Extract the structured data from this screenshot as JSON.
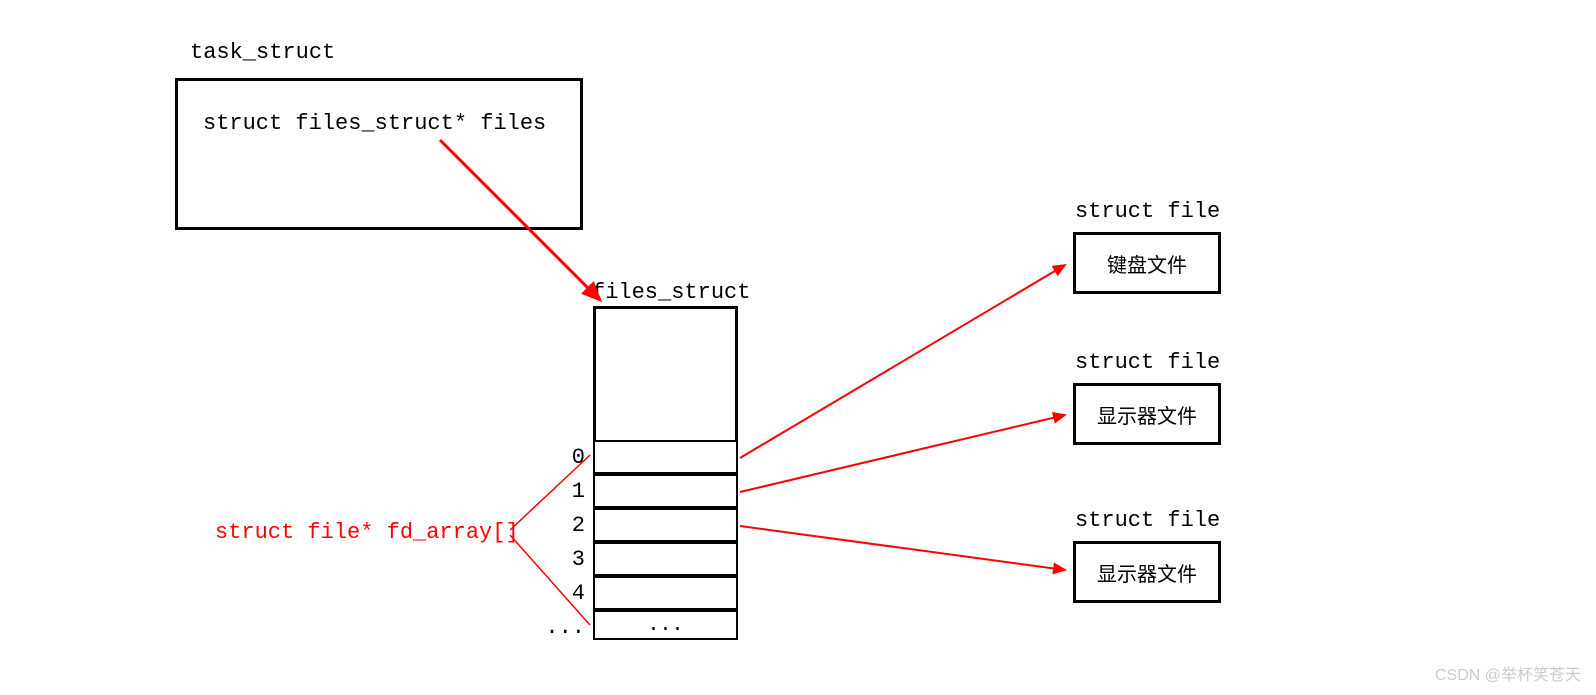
{
  "task_struct": {
    "title": "task_struct",
    "member": "struct files_struct* files"
  },
  "files_struct": {
    "title": "files_struct",
    "array_label": "struct file* fd_array[]",
    "indices": [
      "0",
      "1",
      "2",
      "3",
      "4",
      "..."
    ],
    "ellipsis": "..."
  },
  "file_boxes": [
    {
      "title": "struct file",
      "content": "键盘文件"
    },
    {
      "title": "struct file",
      "content": "显示器文件"
    },
    {
      "title": "struct file",
      "content": "显示器文件"
    }
  ],
  "watermark": "CSDN @举杯笑苍天"
}
